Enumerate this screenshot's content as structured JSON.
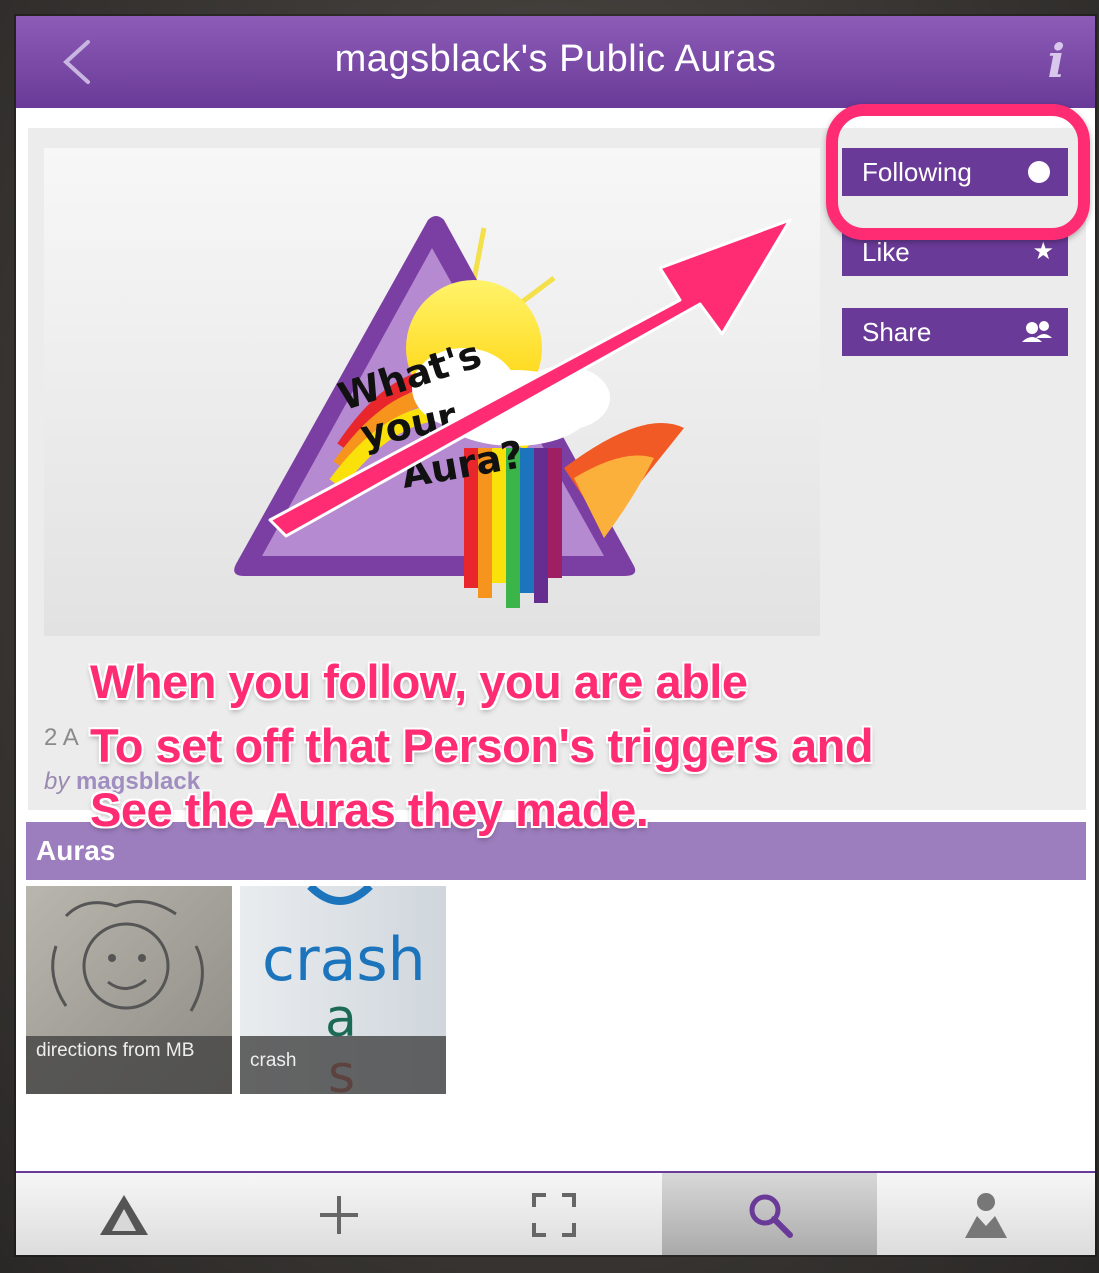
{
  "nav": {
    "title": "magsblack's Public Auras",
    "back_icon": "chevron-left-icon",
    "info_label": "i"
  },
  "profile": {
    "count_text": "2 A",
    "by_prefix": "by",
    "by_name": "magsblack",
    "hero_text": [
      "What's",
      "your",
      "Aura?"
    ]
  },
  "actions": {
    "following_label": "Following",
    "like_label": "Like",
    "share_label": "Share"
  },
  "section": {
    "title": "Auras"
  },
  "auras": [
    {
      "caption": "directions from MB",
      "thumb_icon": "face-sketch-icon"
    },
    {
      "caption": "crash",
      "thumb_text": "crash"
    }
  ],
  "tabs": [
    {
      "name": "home",
      "icon": "aura-logo-icon",
      "active": false
    },
    {
      "name": "create",
      "icon": "plus-icon",
      "active": false
    },
    {
      "name": "scan",
      "icon": "viewfinder-icon",
      "active": false
    },
    {
      "name": "search",
      "icon": "search-icon",
      "active": true
    },
    {
      "name": "profile",
      "icon": "user-icon",
      "active": false
    }
  ],
  "annotation": {
    "lines": [
      "When you follow, you are able",
      "To set off that Person's triggers and",
      "See the Auras they made."
    ],
    "color": "#ff2c74"
  },
  "colors": {
    "brand": "#6a3a98",
    "section": "#9c7dbd",
    "annotation": "#ff2c74"
  }
}
